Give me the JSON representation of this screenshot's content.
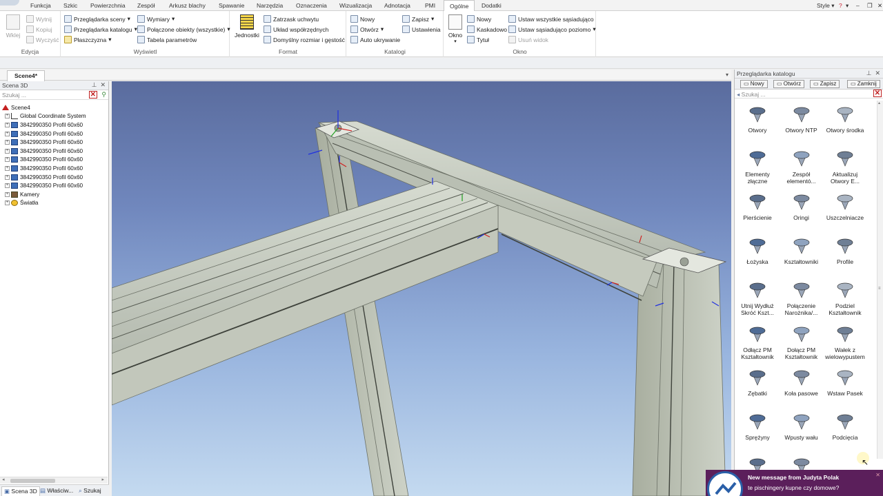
{
  "menu": {
    "tabs": [
      "Funkcja",
      "Szkic",
      "Powierzchnia",
      "Zespół",
      "Arkusz blachy",
      "Spawanie",
      "Narzędzia",
      "Oznaczenia",
      "Wizualizacja",
      "Adnotacja",
      "PMI",
      "Ogólne",
      "Dodatki"
    ],
    "active_tab": "Ogólne",
    "style_label": "Style",
    "help_icon": "help-icon"
  },
  "ribbon": {
    "edycja": {
      "label": "Edycja",
      "wklej": "Wklej",
      "wytnij": "Wytnij",
      "kopiuj": "Kopiuj",
      "wyczysc": "Wyczyść"
    },
    "wyswietl": {
      "label": "Wyświetl",
      "przegladarka_sceny": "Przeglądarka sceny",
      "przegladarka_katalogu": "Przeglądarka katalogu",
      "plaszczyzna": "Płaszczyzna",
      "wymiary": "Wymiary",
      "polaczone": "Połączone obiekty (wszystkie)",
      "tabela": "Tabela parametrów"
    },
    "format": {
      "label": "Format",
      "jednostki": "Jednostki",
      "zatrzask": "Zatrzask uchwytu",
      "uklad": "Układ współrzędnych",
      "domyslny": "Domyślny rozmiar i gęstość"
    },
    "katalogi": {
      "label": "Katalogi",
      "nowy": "Nowy",
      "otworz": "Otwórz",
      "auto": "Auto ukrywanie",
      "zapisz": "Zapisz",
      "ustawienia": "Ustawienia"
    },
    "okno": {
      "label": "Okno",
      "okno": "Okno",
      "nowy": "Nowy",
      "kaskadowo": "Kaskadowo",
      "tytul": "Tytuł",
      "ustaw_wszystkie": "Ustaw wszystkie sąsiadująco",
      "ustaw_poziomo": "Ustaw sąsiadująco poziomo",
      "usun_widok": "Usuń widok"
    }
  },
  "document": {
    "tab": "Scene4*"
  },
  "scene_panel": {
    "title": "Scena 3D",
    "search_placeholder": "Szukaj ...",
    "tree": [
      {
        "label": "Scene4",
        "level": 0,
        "expander": "",
        "icon": "scene-icon"
      },
      {
        "label": "Global Coordinate System",
        "level": 1,
        "expander": "+",
        "icon": "coordinate-system-icon"
      },
      {
        "label": "3842990350 Profil 60x60",
        "level": 1,
        "expander": "+",
        "icon": "profile-part-icon"
      },
      {
        "label": "3842990350 Profil 60x60",
        "level": 1,
        "expander": "+",
        "icon": "profile-part-icon"
      },
      {
        "label": "3842990350 Profil 60x60",
        "level": 1,
        "expander": "+",
        "icon": "profile-part-icon"
      },
      {
        "label": "3842990350 Profil 60x60",
        "level": 1,
        "expander": "+",
        "icon": "profile-part-icon"
      },
      {
        "label": "3842990350 Profil 60x60",
        "level": 1,
        "expander": "+",
        "icon": "profile-part-icon"
      },
      {
        "label": "3842990350 Profil 60x60",
        "level": 1,
        "expander": "+",
        "icon": "profile-part-icon"
      },
      {
        "label": "3842990350 Profil 60x60",
        "level": 1,
        "expander": "+",
        "icon": "profile-part-icon"
      },
      {
        "label": "3842990350 Profil 60x60",
        "level": 1,
        "expander": "+",
        "icon": "profile-part-icon"
      },
      {
        "label": "Kamery",
        "level": 1,
        "expander": "+",
        "icon": "camera-icon"
      },
      {
        "label": "Światła",
        "level": 1,
        "expander": "+",
        "icon": "light-icon"
      }
    ],
    "bottom_tabs": [
      "Scena 3D",
      "Właściw...",
      "Szukaj"
    ]
  },
  "catalog_panel": {
    "title": "Przeglądarka katalogu",
    "buttons": [
      "Nowy",
      "Otwórz",
      "Zapisz",
      "Zamknij"
    ],
    "search_placeholder": "Szukaj ...",
    "items": [
      {
        "label": "Otwory",
        "icon": "countersink-hole-icon"
      },
      {
        "label": "Otwory NTP",
        "icon": "countersink-hole-icon"
      },
      {
        "label": "Otwory środka",
        "icon": "center-hole-icon"
      },
      {
        "label": "Elementy złączne",
        "icon": "fasteners-icon"
      },
      {
        "label": "Zespół elementó...",
        "icon": "bolt-assembly-icon"
      },
      {
        "label": "Aktualizuj Otwory E...",
        "icon": "update-holes-icon"
      },
      {
        "label": "Pierścienie",
        "icon": "ring-icon"
      },
      {
        "label": "Oringi",
        "icon": "oring-icon"
      },
      {
        "label": "Uszczelniacze",
        "icon": "seal-icon"
      },
      {
        "label": "Łożyska",
        "icon": "bearing-icon"
      },
      {
        "label": "Kształtowniki",
        "icon": "section-icon"
      },
      {
        "label": "Profile",
        "icon": "profile-icon"
      },
      {
        "label": "Utnij Wydłuż Skróć Kszt...",
        "icon": "cut-extend-icon"
      },
      {
        "label": "Połączenie Narożnika/...",
        "icon": "corner-joint-icon"
      },
      {
        "label": "Podziel Kształtownik",
        "icon": "split-section-icon"
      },
      {
        "label": "Odłącz PM Kształtownik",
        "icon": "detach-pm-icon"
      },
      {
        "label": "Dołącz PM Kształtownik",
        "icon": "attach-pm-icon"
      },
      {
        "label": "Wałek z wielowypustem",
        "icon": "spline-shaft-icon"
      },
      {
        "label": "Zębatki",
        "icon": "gear-icon"
      },
      {
        "label": "Koła pasowe",
        "icon": "pulley-icon"
      },
      {
        "label": "Wstaw Pasek",
        "icon": "belt-icon"
      },
      {
        "label": "Sprężyny",
        "icon": "spring-icon"
      },
      {
        "label": "Wpusty wału",
        "icon": "shaft-key-icon"
      },
      {
        "label": "Podcięcia",
        "icon": "undercut-icon"
      },
      {
        "label": "",
        "icon": "pin-icon"
      },
      {
        "label": "",
        "icon": "pin-icon"
      }
    ]
  },
  "notification": {
    "title": "New message from Judyta Polak",
    "body": "te pischingery kupne czy domowe?",
    "accent": "#5b1f5b"
  },
  "colors": {
    "viewport_top": "#5a6c9e",
    "viewport_bottom": "#c4daf0",
    "profile_gray": "#c9cfc3"
  }
}
